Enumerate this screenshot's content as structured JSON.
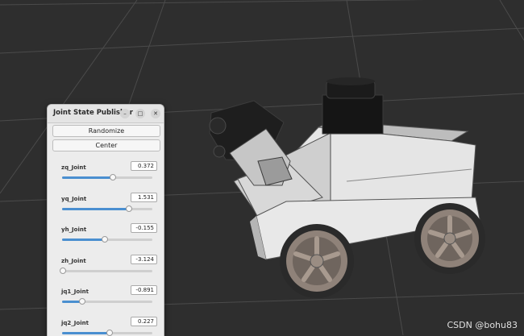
{
  "window": {
    "title": "Joint State Publisher",
    "minimize_icon": "minimize-icon",
    "maximize_icon": "maximize-icon",
    "close_icon": "close-icon"
  },
  "buttons": {
    "randomize": "Randomize",
    "center": "Center"
  },
  "joints": [
    {
      "name": "zq_Joint",
      "value": "0.372",
      "level": 0.56
    },
    {
      "name": "yq_Joint",
      "value": "1.531",
      "level": 0.74
    },
    {
      "name": "yh_Joint",
      "value": "-0.155",
      "level": 0.47
    },
    {
      "name": "zh_Joint",
      "value": "-3.124",
      "level": 0.01
    },
    {
      "name": "jq1_Joint",
      "value": "-0.891",
      "level": 0.22
    },
    {
      "name": "jq2_Joint",
      "value": "0.227",
      "level": 0.53
    }
  ],
  "watermark": "CSDN @bohu83",
  "colors": {
    "scene_background": "#2e2e2e",
    "grid_lines": "#4a4a4a",
    "slider_accent": "#4a8fd0",
    "robot_body": "#e8e8e8",
    "robot_dark": "#1b1b1b",
    "wheel": "#8f8279"
  }
}
